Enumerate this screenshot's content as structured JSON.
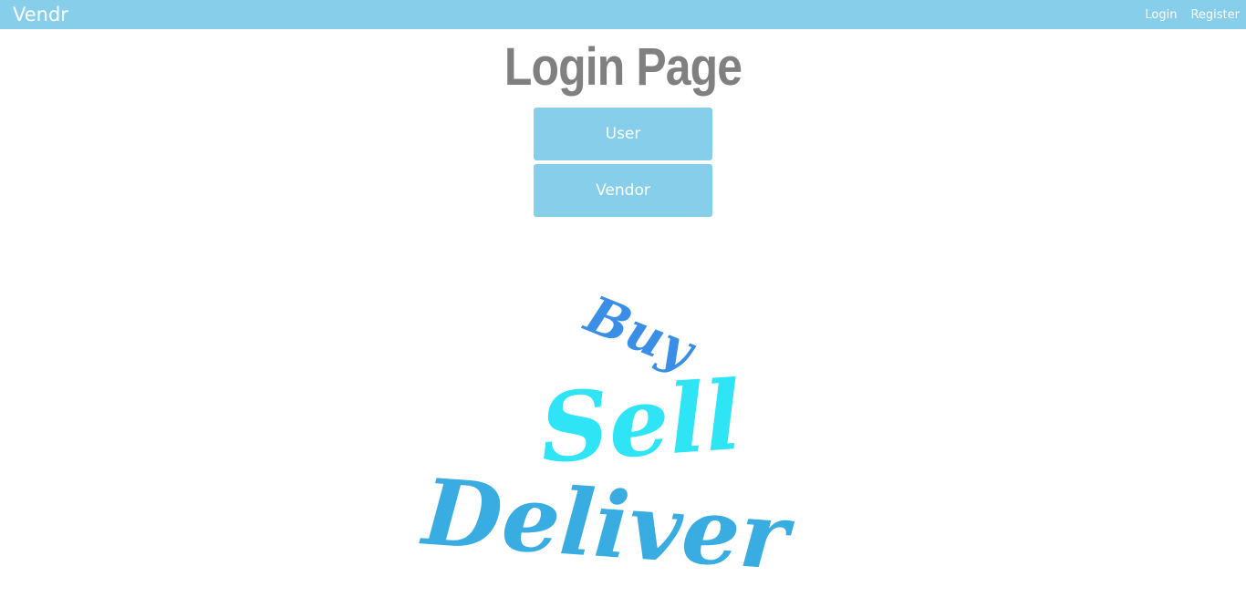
{
  "navbar": {
    "brand": "Vendr",
    "links": [
      "Login",
      "Register"
    ]
  },
  "main": {
    "title": "Login Page",
    "buttons": [
      "User",
      "Vendor"
    ]
  },
  "logo": {
    "words": [
      "Buy",
      "Sell",
      "Deliver"
    ]
  },
  "colors": {
    "navbar": "#87ceeb",
    "button": "#87ceeb",
    "title": "#808080",
    "logo_buy": "#3a8ee6",
    "logo_sell": "#2ee4f5",
    "logo_deliver": "#39ade2"
  }
}
